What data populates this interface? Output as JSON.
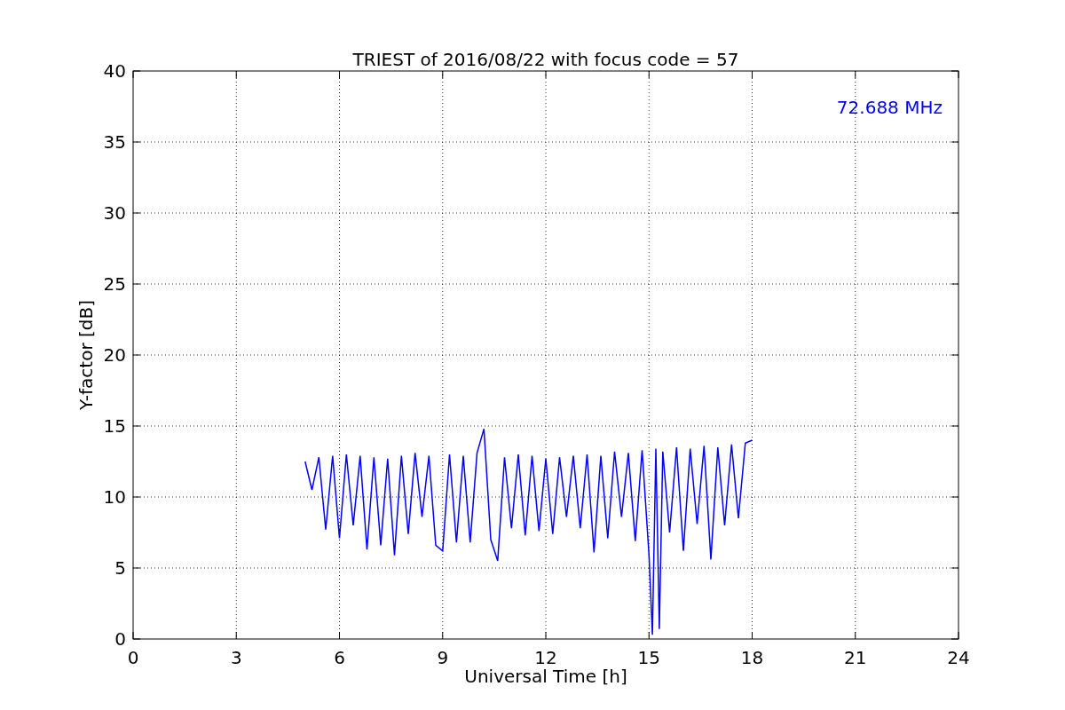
{
  "chart_data": {
    "type": "line",
    "title": "TRIEST of 2016/08/22 with focus code = 57",
    "xlabel": "Universal Time [h]",
    "ylabel": "Y-factor [dB]",
    "grid": true,
    "xlim": [
      0,
      24
    ],
    "ylim": [
      0,
      40
    ],
    "xticks": [
      0,
      3,
      6,
      9,
      12,
      15,
      18,
      21,
      24
    ],
    "yticks": [
      0,
      5,
      10,
      15,
      20,
      25,
      30,
      35,
      40
    ],
    "x": [
      5.0,
      5.2,
      5.4,
      5.6,
      5.8,
      6.0,
      6.2,
      6.4,
      6.6,
      6.8,
      7.0,
      7.2,
      7.4,
      7.6,
      7.8,
      8.0,
      8.2,
      8.4,
      8.6,
      8.8,
      9.0,
      9.2,
      9.4,
      9.6,
      9.8,
      10.0,
      10.2,
      10.4,
      10.6,
      10.8,
      11.0,
      11.2,
      11.4,
      11.6,
      11.8,
      12.0,
      12.2,
      12.4,
      12.6,
      12.8,
      13.0,
      13.2,
      13.4,
      13.6,
      13.8,
      14.0,
      14.2,
      14.4,
      14.6,
      14.8,
      15.0,
      15.1,
      15.2,
      15.3,
      15.4,
      15.6,
      15.8,
      16.0,
      16.2,
      16.4,
      16.6,
      16.8,
      17.0,
      17.2,
      17.4,
      17.6,
      17.8,
      18.0
    ],
    "series": [
      {
        "name": "72.688 MHz",
        "color": "#0000ff",
        "values": [
          12.5,
          10.5,
          12.8,
          7.7,
          12.9,
          7.1,
          13.0,
          8.0,
          12.9,
          6.3,
          12.8,
          6.6,
          12.7,
          5.9,
          12.9,
          7.4,
          13.1,
          8.6,
          12.9,
          6.6,
          6.2,
          13.0,
          6.8,
          12.9,
          6.8,
          13.1,
          14.8,
          7.0,
          5.5,
          12.8,
          7.8,
          13.0,
          7.3,
          12.9,
          7.6,
          12.7,
          7.4,
          12.8,
          8.6,
          12.9,
          7.8,
          13.0,
          6.1,
          12.9,
          7.1,
          13.2,
          8.6,
          13.1,
          6.9,
          13.3,
          5.9,
          0.3,
          13.4,
          0.7,
          13.2,
          7.5,
          13.5,
          6.2,
          13.4,
          8.1,
          13.6,
          5.6,
          13.5,
          8.0,
          13.7,
          8.5,
          13.8,
          14.0
        ]
      }
    ]
  }
}
